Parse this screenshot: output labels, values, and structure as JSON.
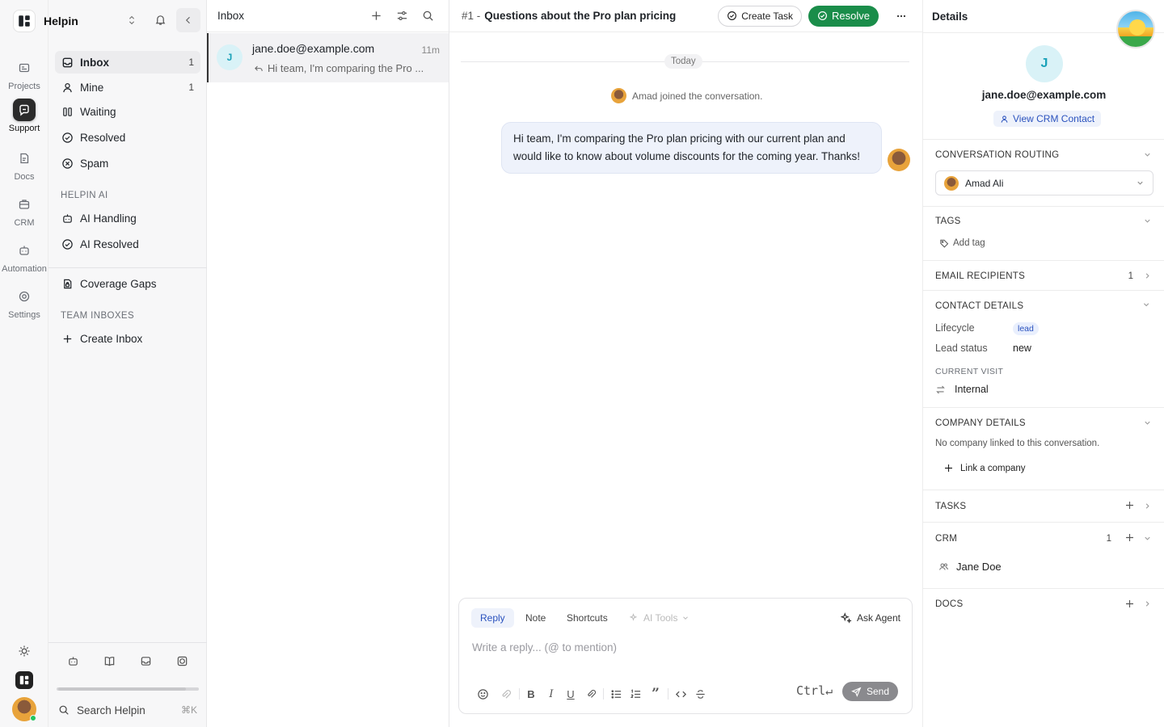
{
  "workspace": {
    "name": "Helpin"
  },
  "rail": {
    "items": [
      {
        "label": "Projects"
      },
      {
        "label": "Support"
      },
      {
        "label": "Docs"
      },
      {
        "label": "CRM"
      },
      {
        "label": "Automation"
      },
      {
        "label": "Settings"
      }
    ]
  },
  "sidebar": {
    "nav": [
      {
        "label": "Inbox",
        "count": "1"
      },
      {
        "label": "Mine",
        "count": "1"
      },
      {
        "label": "Waiting"
      },
      {
        "label": "Resolved"
      },
      {
        "label": "Spam"
      }
    ],
    "ai_section": "HELPIN AI",
    "ai_items": [
      {
        "label": "AI Handling"
      },
      {
        "label": "AI Resolved"
      }
    ],
    "coverage": "Coverage Gaps",
    "team_section": "TEAM INBOXES",
    "create_inbox": "Create Inbox",
    "search_label": "Search Helpin",
    "search_shortcut": "⌘K"
  },
  "list": {
    "title": "Inbox",
    "conversations": [
      {
        "avatar": "J",
        "from": "jane.doe@example.com",
        "time": "11m",
        "preview": "Hi team, I'm comparing the Pro ..."
      }
    ]
  },
  "conversation": {
    "number": "#1 -",
    "title": "Questions about the Pro plan pricing",
    "create_task": "Create Task",
    "resolve": "Resolve",
    "day_divider": "Today",
    "event": "Amad joined the conversation.",
    "message": "Hi team, I'm comparing the Pro plan pricing with our current plan and would like to know about volume discounts for the coming year. Thanks!"
  },
  "composer": {
    "tabs": [
      "Reply",
      "Note",
      "Shortcuts",
      "AI Tools"
    ],
    "ask_agent": "Ask Agent",
    "placeholder": "Write a reply... (@ to mention)",
    "shortcut": "Ctrl↵",
    "send": "Send"
  },
  "details": {
    "title": "Details",
    "contact_avatar": "J",
    "contact_email": "jane.doe@example.com",
    "view_crm": "View CRM Contact",
    "routing": {
      "title": "CONVERSATION ROUTING",
      "assignee": "Amad Ali"
    },
    "tags": {
      "title": "TAGS",
      "add": "Add tag"
    },
    "email_recipients": {
      "title": "EMAIL RECIPIENTS",
      "count": "1"
    },
    "contact_details": {
      "title": "CONTACT DETAILS",
      "lifecycle_label": "Lifecycle",
      "lifecycle_value": "lead",
      "lead_status_label": "Lead status",
      "lead_status_value": "new",
      "current_visit_title": "CURRENT VISIT",
      "current_visit_value": "Internal"
    },
    "company": {
      "title": "COMPANY DETAILS",
      "empty": "No company linked to this conversation.",
      "link": "Link a company"
    },
    "tasks": {
      "title": "TASKS"
    },
    "crm": {
      "title": "CRM",
      "count": "1",
      "contact": "Jane Doe"
    },
    "docs": {
      "title": "DOCS"
    }
  },
  "colors": {
    "accent": "#1a8d4a",
    "link": "#2a52be",
    "bubble": "#eef2fb"
  }
}
